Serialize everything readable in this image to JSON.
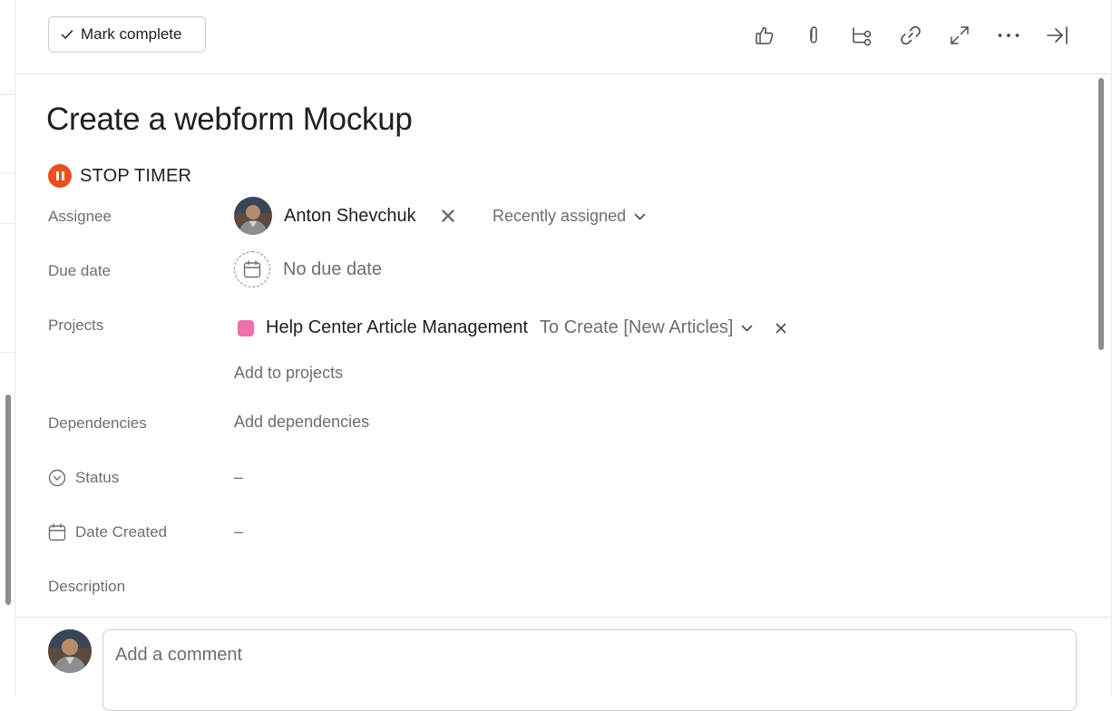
{
  "toolbar": {
    "mark_complete_label": "Mark complete",
    "icons": [
      "thumbs-up-icon",
      "paperclip-icon",
      "subtask-icon",
      "link-icon",
      "expand-icon",
      "more-icon",
      "close-panel-icon"
    ]
  },
  "task": {
    "title": "Create a webform Mockup",
    "timer_label": "STOP TIMER"
  },
  "fields": {
    "assignee_label": "Assignee",
    "assignee_name": "Anton Shevchuk",
    "recently_assigned": "Recently assigned",
    "due_date_label": "Due date",
    "due_date_value": "No due date",
    "projects_label": "Projects",
    "project_name": "Help Center Article Management",
    "project_section": "To Create [New Articles]",
    "add_to_projects": "Add to projects",
    "dependencies_label": "Dependencies",
    "add_dependencies": "Add dependencies",
    "status_label": "Status",
    "status_value": "–",
    "date_created_label": "Date Created",
    "date_created_value": "–",
    "description_label": "Description"
  },
  "comment": {
    "placeholder": "Add a comment"
  },
  "colors": {
    "timer": "#e8501f",
    "project_swatch": "#f06fae",
    "muted_text": "#6d6e6f"
  }
}
